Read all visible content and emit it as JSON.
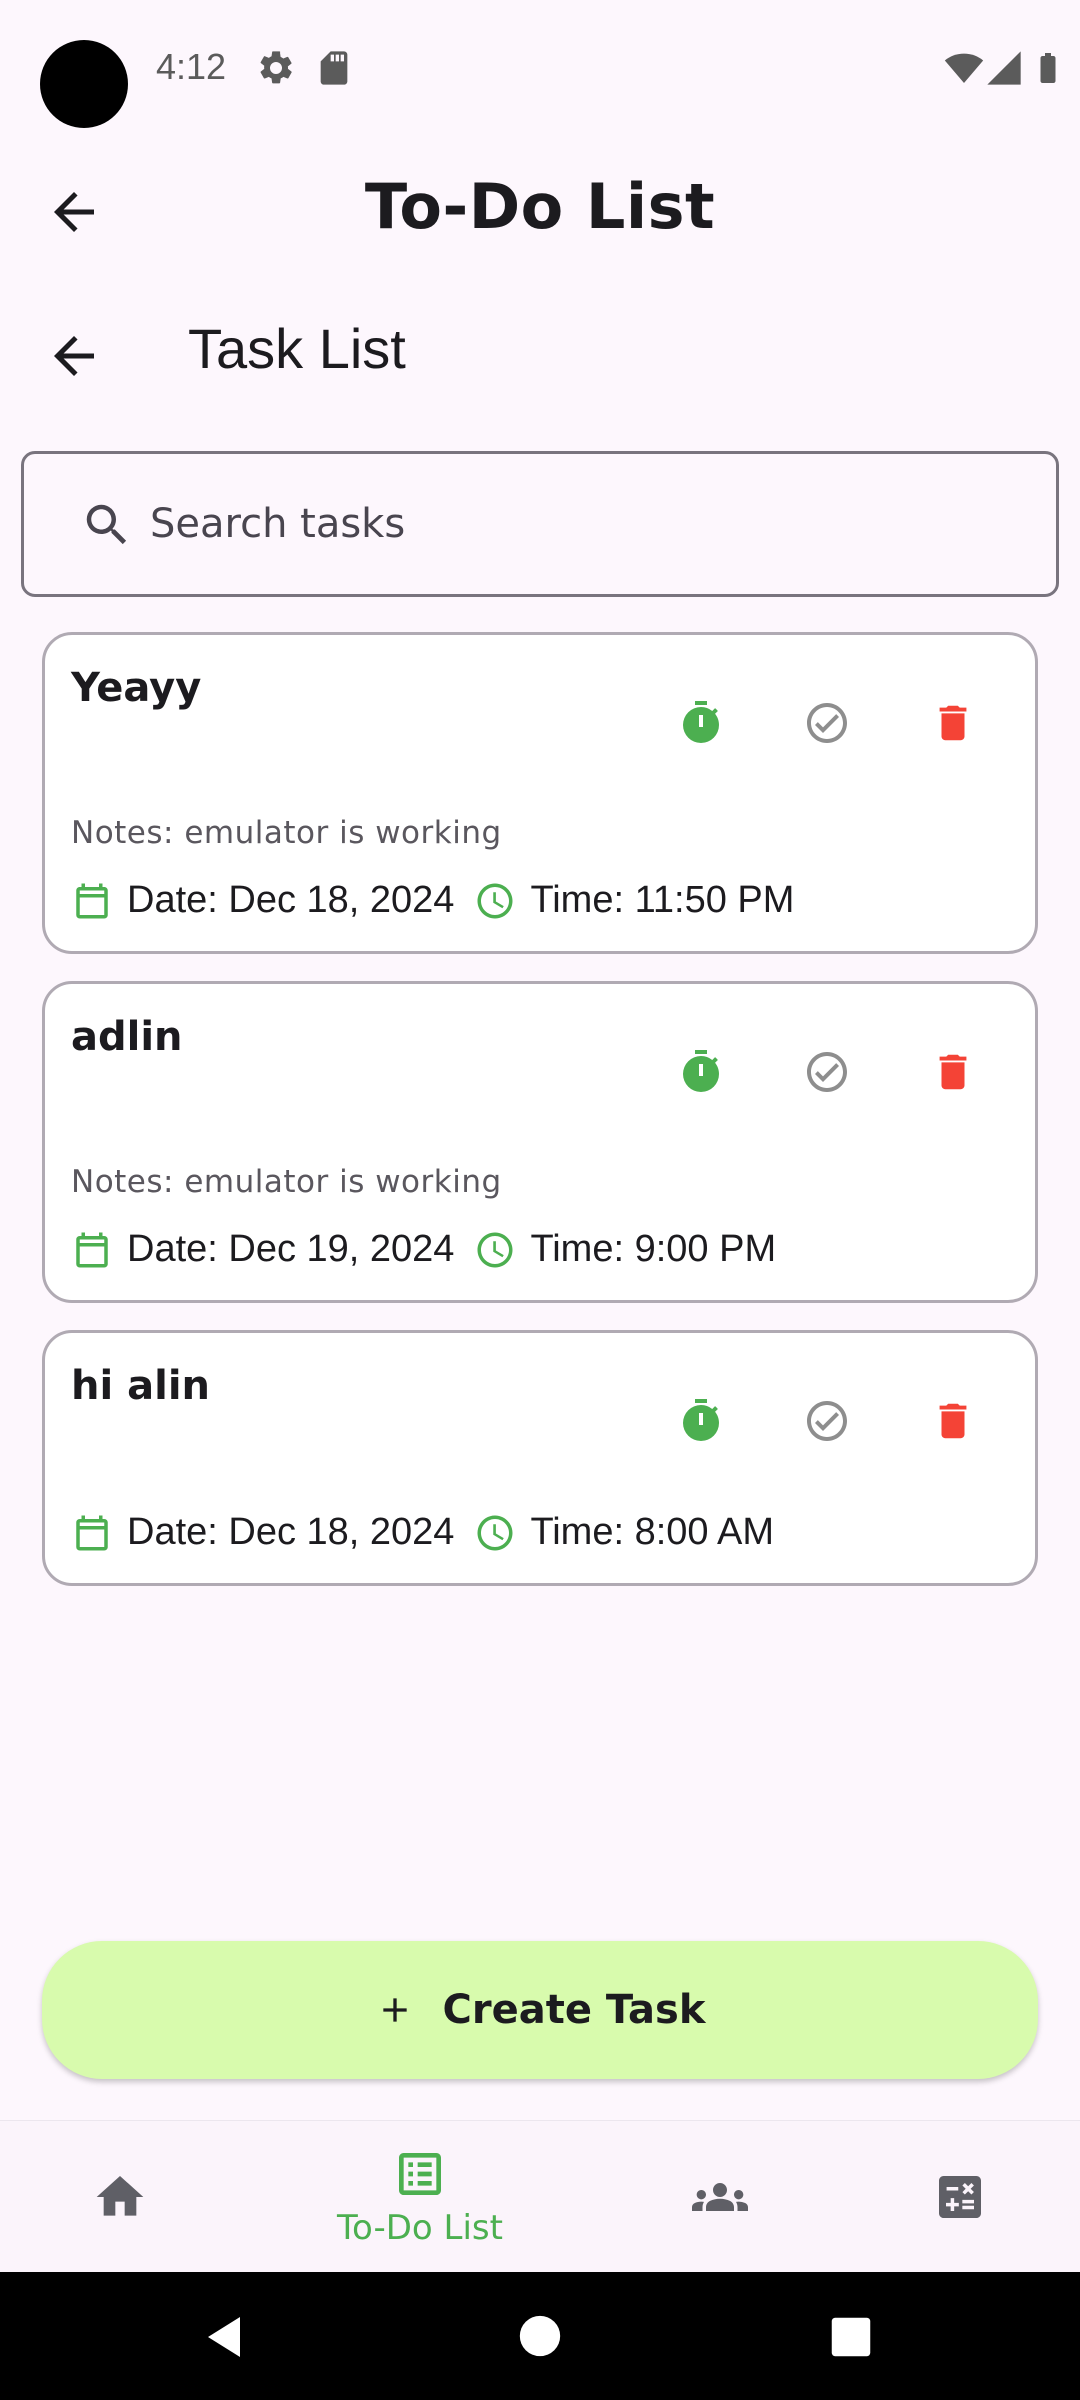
{
  "status_bar": {
    "time": "4:12",
    "icons": [
      "settings-icon",
      "sd-card-icon",
      "wifi-icon",
      "signal-icon",
      "battery-icon"
    ]
  },
  "app_bar": {
    "title": "To-Do List",
    "back_icon": "arrow-back-icon"
  },
  "sub_header": {
    "title": "Task List",
    "back_icon": "arrow-back-icon"
  },
  "search": {
    "placeholder": "Search tasks",
    "value": ""
  },
  "tasks": [
    {
      "title": "Yeayy",
      "notes": "Notes: emulator is working",
      "date": "Date: Dec 18, 2024",
      "time": "Time: 11:50 PM"
    },
    {
      "title": "adlin",
      "notes": "Notes: emulator is working",
      "date": "Date: Dec 19, 2024",
      "time": "Time: 9:00 PM"
    },
    {
      "title": "hi alin",
      "notes": "",
      "date": "Date: Dec 18, 2024",
      "time": "Time: 8:00 AM"
    }
  ],
  "create_button": {
    "label": "Create Task"
  },
  "bottom_nav": {
    "items": [
      {
        "icon": "home-icon",
        "label": ""
      },
      {
        "icon": "list-icon",
        "label": "To-Do List",
        "active": true
      },
      {
        "icon": "group-icon",
        "label": ""
      },
      {
        "icon": "calculator-icon",
        "label": ""
      }
    ]
  },
  "colors": {
    "accent_green": "#4caf50",
    "delete_red": "#f44336",
    "check_grey": "#8e8e8e",
    "create_button_bg": "#d8fbad",
    "background": "#fdf7fd"
  }
}
